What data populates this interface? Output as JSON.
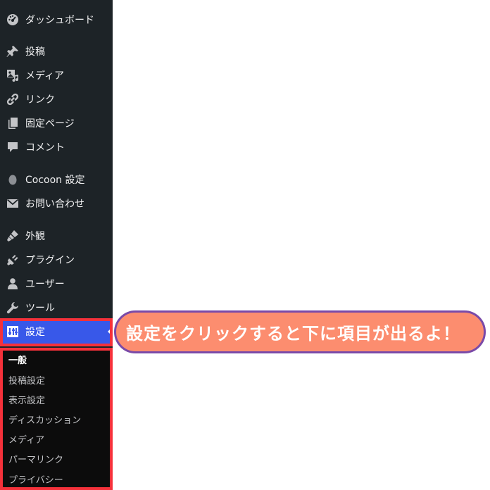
{
  "menu": {
    "dashboard": "ダッシュボード",
    "posts": "投稿",
    "media": "メディア",
    "links": "リンク",
    "pages": "固定ページ",
    "comments": "コメント",
    "cocoon": "Cocoon 設定",
    "contact": "お問い合わせ",
    "appearance": "外観",
    "plugins": "プラグイン",
    "users": "ユーザー",
    "tools": "ツール",
    "settings": "設定"
  },
  "submenu": {
    "general": "一般",
    "writing": "投稿設定",
    "reading": "表示設定",
    "discussion": "ディスカッション",
    "media": "メディア",
    "permalinks": "パーマリンク",
    "privacy": "プライバシー"
  },
  "callout": {
    "text": "設定をクリックすると下に項目が出るよ！"
  },
  "colors": {
    "sidebar_bg": "#1d2327",
    "active_bg": "#3858e9",
    "highlight_border": "#f5313a",
    "callout_bg": "#fc8d6f",
    "callout_border": "#7a4aa8"
  },
  "icons": {
    "dashboard": "dashboard-icon",
    "posts": "pin-icon",
    "media": "media-icon",
    "links": "link-icon",
    "pages": "pages-icon",
    "comments": "comment-icon",
    "cocoon": "cocoon-icon",
    "contact": "mail-icon",
    "appearance": "brush-icon",
    "plugins": "plugin-icon",
    "users": "user-icon",
    "tools": "wrench-icon",
    "settings": "settings-icon"
  }
}
